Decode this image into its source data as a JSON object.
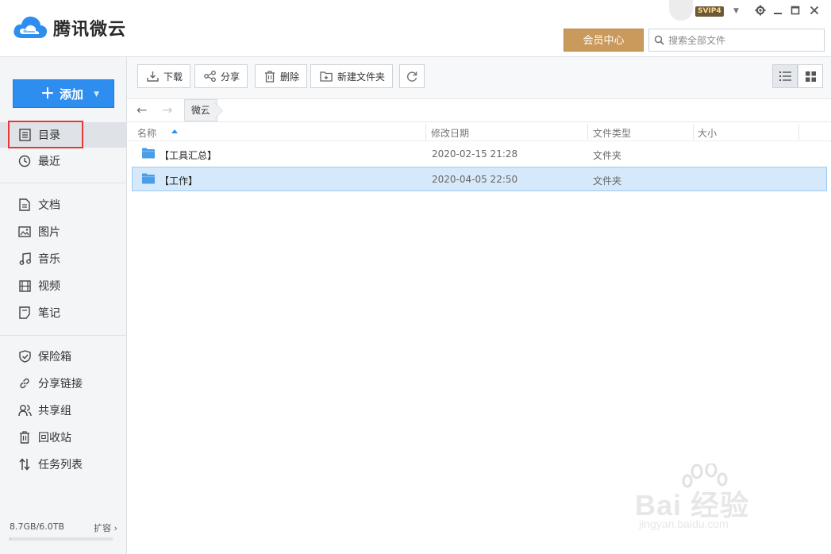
{
  "app": {
    "name": "腾讯微云",
    "vip_badge": "SVIP4",
    "member_center": "会员中心",
    "search_placeholder": "搜索全部文件"
  },
  "sidebar": {
    "add_label": "添加",
    "group1": [
      {
        "label": "目录",
        "icon": "directory-icon",
        "active": true
      },
      {
        "label": "最近",
        "icon": "clock-icon"
      }
    ],
    "group2": [
      {
        "label": "文档",
        "icon": "document-icon"
      },
      {
        "label": "图片",
        "icon": "image-icon"
      },
      {
        "label": "音乐",
        "icon": "music-icon"
      },
      {
        "label": "视频",
        "icon": "video-icon"
      },
      {
        "label": "笔记",
        "icon": "note-icon"
      }
    ],
    "group3": [
      {
        "label": "保险箱",
        "icon": "shield-icon"
      },
      {
        "label": "分享链接",
        "icon": "link-icon"
      },
      {
        "label": "共享组",
        "icon": "group-icon"
      },
      {
        "label": "回收站",
        "icon": "trash-icon"
      },
      {
        "label": "任务列表",
        "icon": "transfer-icon"
      }
    ],
    "storage": "8.7GB/6.0TB",
    "storage_used_fraction": 0.002,
    "expand_label": "扩容"
  },
  "toolbar": {
    "download": "下载",
    "share": "分享",
    "delete": "删除",
    "new_folder": "新建文件夹"
  },
  "breadcrumb": {
    "current": "微云"
  },
  "columns": {
    "name": "名称",
    "modified": "修改日期",
    "type": "文件类型",
    "size": "大小"
  },
  "files": [
    {
      "name": "【工具汇总】",
      "modified": "2020-02-15 21:28",
      "type": "文件夹",
      "selected": false
    },
    {
      "name": "【工作】",
      "modified": "2020-04-05 22:50",
      "type": "文件夹",
      "selected": true
    }
  ],
  "watermark": {
    "logo": "Bai 经验",
    "url": "jingyan.baidu.com"
  },
  "colors": {
    "accent_blue": "#2e8ef0",
    "member_gold": "#c99a5b",
    "selection": "#d6e9fb",
    "highlight_red": "#e53935"
  }
}
